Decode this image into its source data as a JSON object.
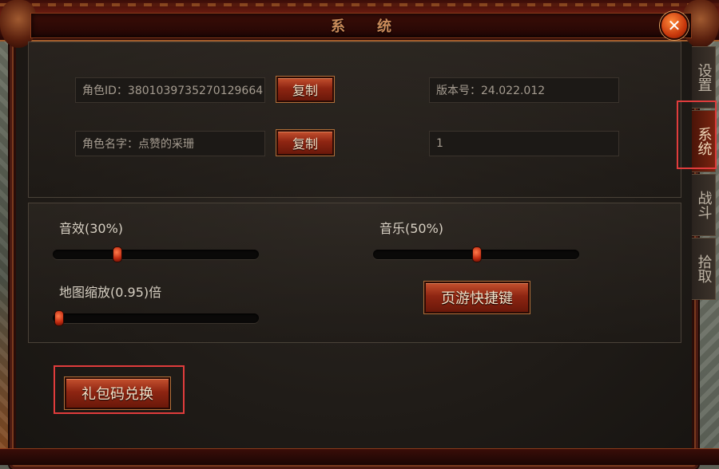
{
  "window": {
    "title": "系统",
    "close_icon": "close-icon"
  },
  "info": {
    "role_id": "角色ID：3801039735270129664",
    "role_name": "角色名字：点赞的采珊",
    "copy_label": "复制",
    "version": "版本号：24.022.012",
    "extra_value": "1"
  },
  "audio": {
    "sound_label": "音效(30%)",
    "sound_value": 0.3,
    "music_label": "音乐(50%)",
    "music_value": 0.5,
    "zoom_label": "地图缩放(0.95)倍",
    "zoom_value": 0.0,
    "hotkey_label": "页游快捷键"
  },
  "gift": {
    "redeem_label": "礼包码兑换"
  },
  "tabs": [
    {
      "label": "设置",
      "active": false
    },
    {
      "label": "系统",
      "active": true
    },
    {
      "label": "战斗",
      "active": false
    },
    {
      "label": "拾取",
      "active": false
    }
  ],
  "colors": {
    "highlight": "#e03c3c",
    "accent": "#c4502e"
  }
}
